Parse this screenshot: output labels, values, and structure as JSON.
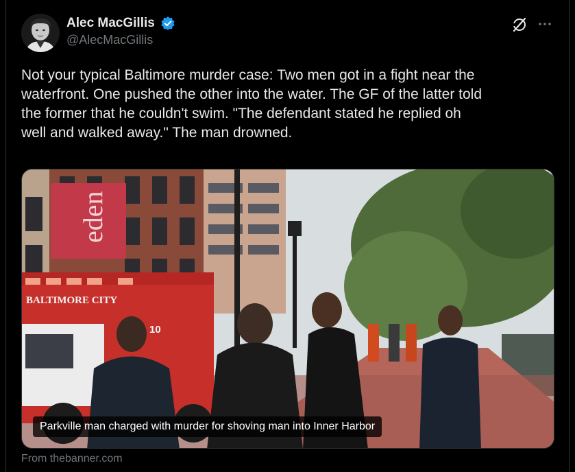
{
  "author": {
    "display_name": "Alec MacGillis",
    "handle": "@AlecMacGillis",
    "verified": true
  },
  "icons": {
    "avatar": "profile-photo",
    "verified": "verified-badge-icon",
    "grok": "grok-icon",
    "more": "more-options-icon"
  },
  "tweet": {
    "text": "Not your typical Baltimore murder case: Two men got in a fight near the\nwaterfront. One pushed the other into the water. The GF of the latter told\nthe former that he couldn't swim. \"The defendant stated he replied oh\nwell and walked away.\" The man drowned."
  },
  "link_card": {
    "headline": "Parkville man charged with murder for shoving man into Inner Harbor",
    "source": "From thebanner.com"
  },
  "photo_text": {
    "storefront_sign": "eden",
    "ambulance_label": "BALTIMORE CITY",
    "unit_number": "10"
  },
  "colors": {
    "background": "#000000",
    "text_primary": "#e7e9ea",
    "text_secondary": "#71767b",
    "verified_blue": "#1d9bf0",
    "border": "#2f3336"
  }
}
